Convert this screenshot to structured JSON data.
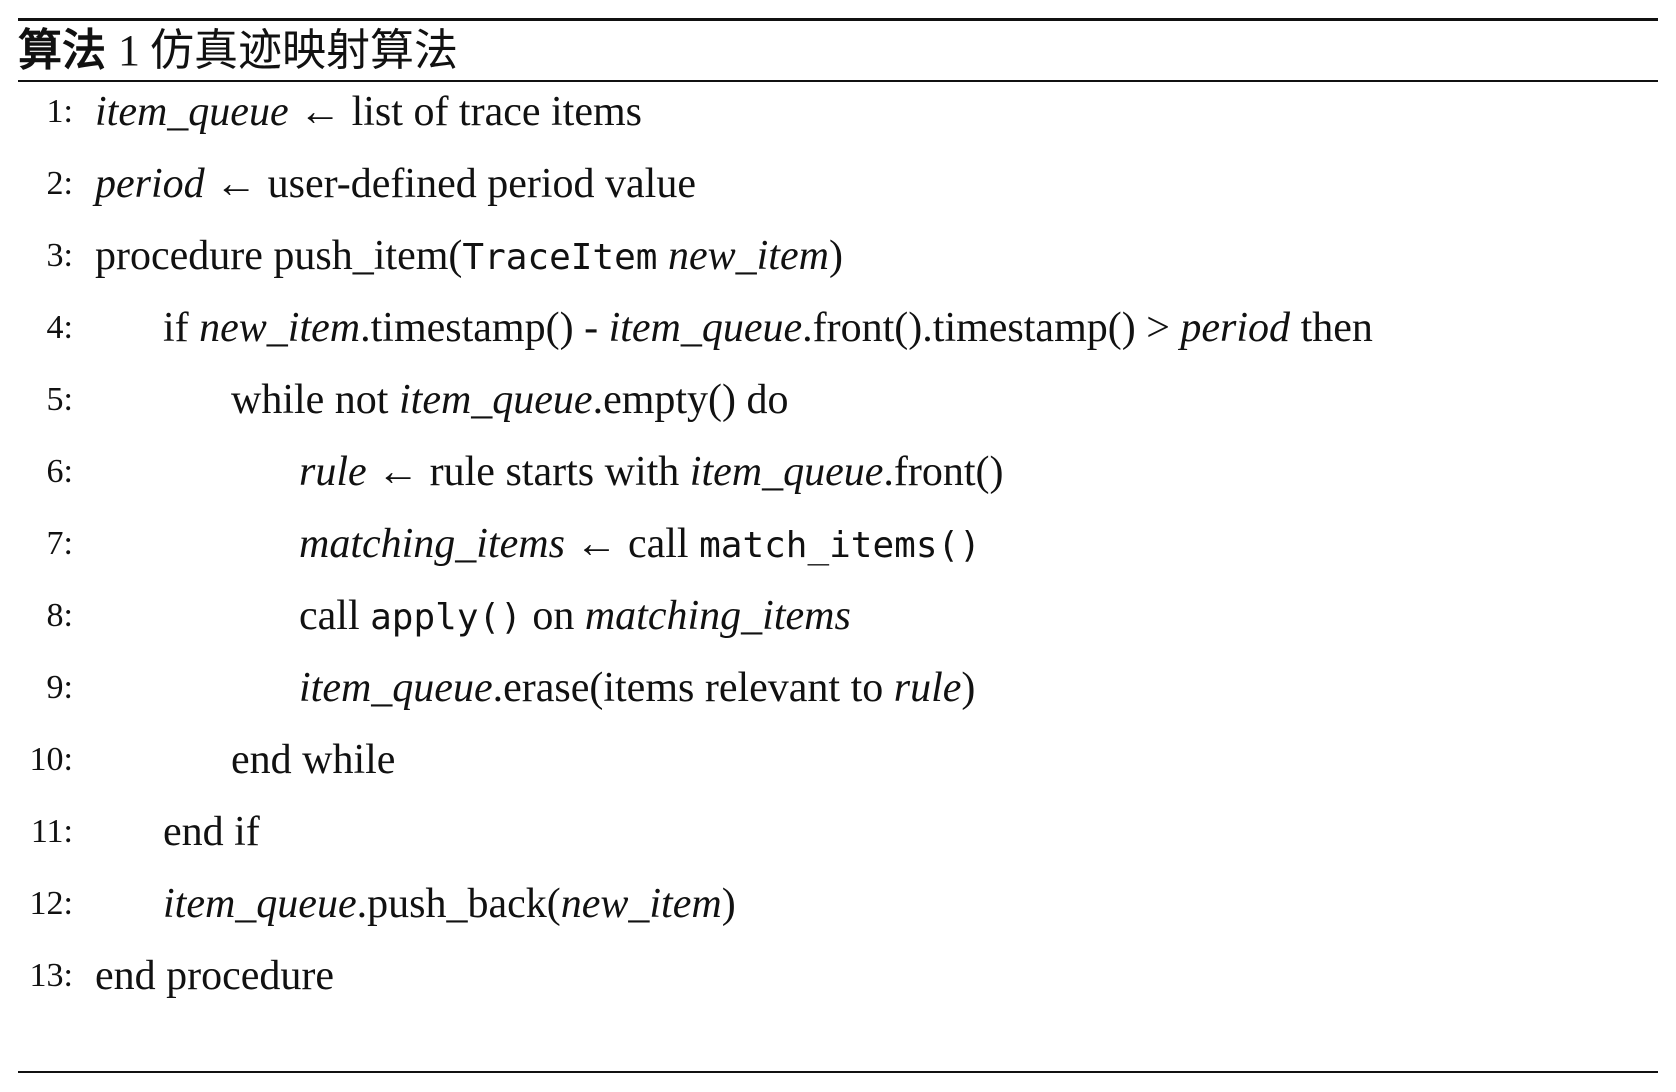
{
  "caption": {
    "label": "算法",
    "number": "1",
    "title": "仿真迹映射算法"
  },
  "lines": [
    {
      "no": "1:",
      "segments": [
        {
          "t": "item_queue",
          "s": "it"
        },
        {
          "t": " ← list of trace items"
        }
      ]
    },
    {
      "no": "2:",
      "segments": [
        {
          "t": "period",
          "s": "it"
        },
        {
          "t": " ← user-defined period value"
        }
      ]
    },
    {
      "no": "3:",
      "segments": [
        {
          "t": "procedure push_item("
        },
        {
          "t": "TraceItem",
          "s": "tt"
        },
        {
          "t": " "
        },
        {
          "t": "new_item",
          "s": "it"
        },
        {
          "t": ")"
        }
      ]
    },
    {
      "no": "4:",
      "indent": 1,
      "segments": [
        {
          "t": "if "
        },
        {
          "t": "new_item",
          "s": "it"
        },
        {
          "t": ".timestamp() - "
        },
        {
          "t": "item_queue",
          "s": "it"
        },
        {
          "t": ".front().timestamp() > "
        },
        {
          "t": "period",
          "s": "it"
        },
        {
          "t": " then"
        }
      ]
    },
    {
      "no": "5:",
      "indent": 2,
      "segments": [
        {
          "t": "while not "
        },
        {
          "t": "item_queue",
          "s": "it"
        },
        {
          "t": ".empty() do"
        }
      ]
    },
    {
      "no": "6:",
      "indent": 3,
      "segments": [
        {
          "t": "rule",
          "s": "it"
        },
        {
          "t": " ← rule starts with "
        },
        {
          "t": "item_queue",
          "s": "it"
        },
        {
          "t": ".front()"
        }
      ]
    },
    {
      "no": "7:",
      "indent": 3,
      "segments": [
        {
          "t": "matching_items",
          "s": "it"
        },
        {
          "t": " ← call "
        },
        {
          "t": "match_items()",
          "s": "tt"
        }
      ]
    },
    {
      "no": "8:",
      "indent": 3,
      "segments": [
        {
          "t": "call "
        },
        {
          "t": "apply()",
          "s": "tt"
        },
        {
          "t": " on "
        },
        {
          "t": "matching_items",
          "s": "it"
        }
      ]
    },
    {
      "no": "9:",
      "indent": 3,
      "segments": [
        {
          "t": "item_queue",
          "s": "it"
        },
        {
          "t": ".erase(items relevant to "
        },
        {
          "t": "rule",
          "s": "it"
        },
        {
          "t": ")"
        }
      ]
    },
    {
      "no": "10:",
      "indent": 2,
      "segments": [
        {
          "t": "end while"
        }
      ]
    },
    {
      "no": "11:",
      "indent": 1,
      "segments": [
        {
          "t": "end if"
        }
      ]
    },
    {
      "no": "12:",
      "indent": 1,
      "segments": [
        {
          "t": "item_queue",
          "s": "it"
        },
        {
          "t": ".push_back("
        },
        {
          "t": "new_item",
          "s": "it"
        },
        {
          "t": ")"
        }
      ]
    },
    {
      "no": "13:",
      "segments": [
        {
          "t": "end procedure"
        }
      ]
    }
  ]
}
